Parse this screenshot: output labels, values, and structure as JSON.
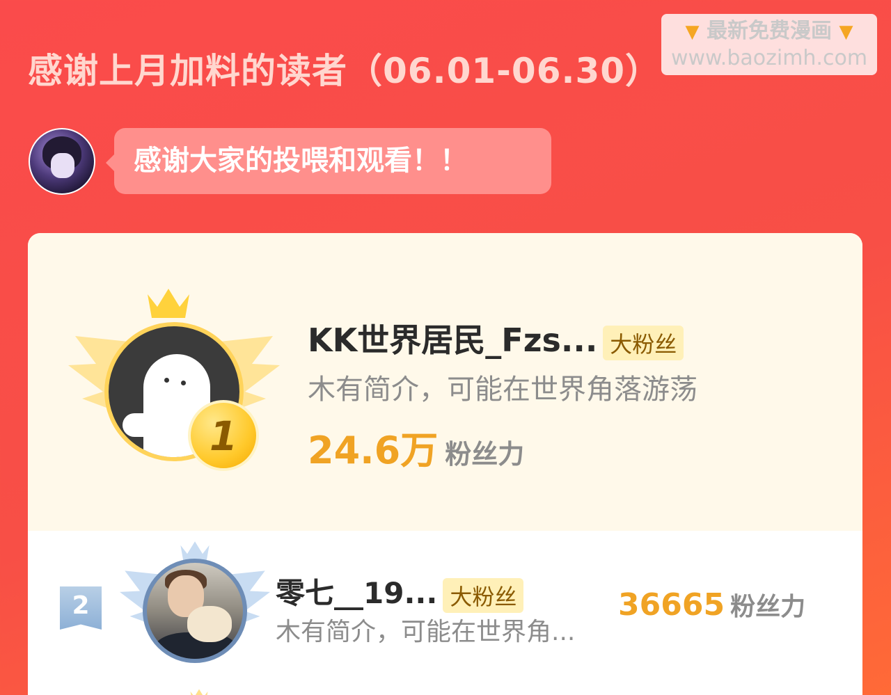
{
  "page": {
    "title": "感谢上月加料的读者（06.01-06.30）"
  },
  "watermark": {
    "line1": "最新免费漫画",
    "line2": "www.baozimh.com",
    "pointer_icon": "pointing-down-finger-icon"
  },
  "message": {
    "text": "感谢大家的投喂和观看！！"
  },
  "colors": {
    "background": "#fa4b4b",
    "gold": "#f0a324",
    "rank1_bg": "#fff9ea",
    "tag_bg": "#fff0b8"
  },
  "ranking": [
    {
      "rank": "1",
      "name": "KK世界居民_Fzs...",
      "tag": "大粉丝",
      "description": "木有简介，可能在世界角落游荡",
      "score": "24.6万",
      "score_unit": "粉丝力"
    },
    {
      "rank": "2",
      "name": "零七__19...",
      "tag": "大粉丝",
      "description": "木有简介，可能在世界角...",
      "score": "36665",
      "score_unit": "粉丝力"
    }
  ]
}
